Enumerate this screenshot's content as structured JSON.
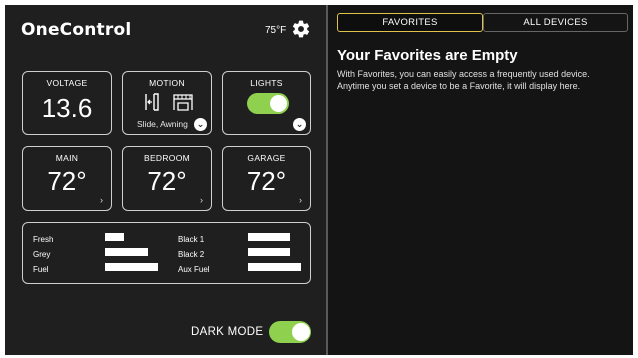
{
  "app": {
    "title": "OneControl",
    "temperature": "75°F"
  },
  "cards": {
    "voltage": {
      "label": "VOLTAGE",
      "value": "13.6"
    },
    "motion": {
      "label": "MOTION",
      "sub": "Slide, Awning"
    },
    "lights": {
      "label": "LIGHTS",
      "state": "on"
    },
    "main": {
      "label": "MAIN",
      "value": "72°"
    },
    "bedroom": {
      "label": "BEDROOM",
      "value": "72°"
    },
    "garage": {
      "label": "GARAGE",
      "value": "72°"
    }
  },
  "tanks": {
    "fresh": {
      "label": "Fresh"
    },
    "grey": {
      "label": "Grey"
    },
    "fuel": {
      "label": "Fuel"
    },
    "black1": {
      "label": "Black 1"
    },
    "black2": {
      "label": "Black 2"
    },
    "aux_fuel": {
      "label": "Aux Fuel"
    }
  },
  "dark_mode": {
    "label": "DARK MODE",
    "state": "on"
  },
  "tabs": {
    "favorites": "FAVORITES",
    "all_devices": "ALL DEVICES",
    "active": "favorites"
  },
  "favorites": {
    "empty_title": "Your Favorites are Empty",
    "empty_description": "With Favorites, you can easily access a frequently used device. Anytime you set a device to be a Favorite, it will display here."
  },
  "colors": {
    "accent_green": "#8fd14f",
    "tab_active_border": "#e0c34a",
    "panel_dark": "#1f1f1f"
  },
  "icons": {
    "settings": "gear-icon",
    "slide": "slide-icon",
    "awning": "awning-icon",
    "chevron": "chevron-right-icon",
    "dropdown": "chevron-down-icon"
  }
}
